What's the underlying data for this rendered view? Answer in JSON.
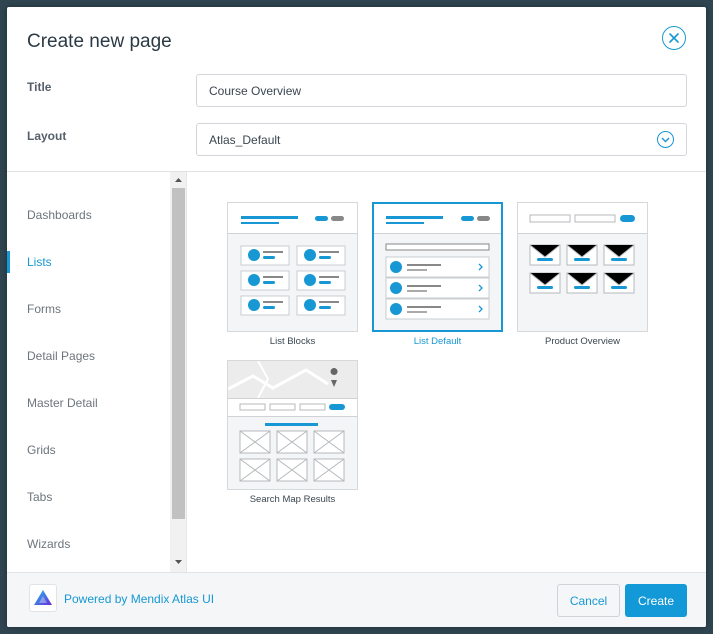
{
  "dialog": {
    "title": "Create new page",
    "close_icon": "close-circle-icon"
  },
  "form": {
    "title_label": "Title",
    "title_value": "Course Overview",
    "layout_label": "Layout",
    "layout_value": "Atlas_Default",
    "layout_icon": "chevron-down-circle-icon"
  },
  "sidebar": {
    "active": "Lists",
    "items": [
      {
        "label": "Dashboards"
      },
      {
        "label": "Lists"
      },
      {
        "label": "Forms"
      },
      {
        "label": "Detail Pages"
      },
      {
        "label": "Master Detail"
      },
      {
        "label": "Grids"
      },
      {
        "label": "Tabs"
      },
      {
        "label": "Wizards"
      }
    ]
  },
  "templates": [
    {
      "label": "List Blocks"
    },
    {
      "label": "List Default"
    },
    {
      "label": "Product Overview"
    },
    {
      "label": "Search Map Results"
    }
  ],
  "selected_template": "List Default",
  "footer": {
    "powered_by": "Powered by Mendix Atlas UI",
    "logo_icon": "mendix-atlas-logo-icon",
    "cancel_label": "Cancel",
    "create_label": "Create"
  },
  "colors": {
    "accent": "#1798d4",
    "backdrop": "#2f4550",
    "footer_bg": "#f5f6f7"
  }
}
